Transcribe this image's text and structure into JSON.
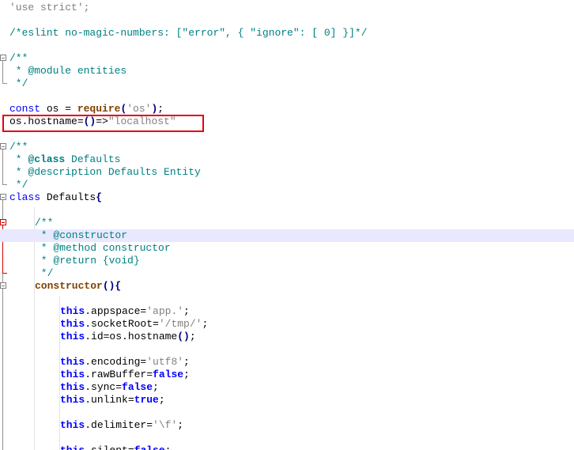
{
  "editor": {
    "highlighted_line": 18,
    "lines": [
      {
        "indent": 0,
        "tokens": [
          {
            "t": "str",
            "v": "'use strict';"
          }
        ]
      },
      {
        "indent": 0,
        "tokens": []
      },
      {
        "indent": 0,
        "tokens": [
          {
            "t": "cm",
            "v": "/*eslint no-magic-numbers: [\"error\", { \"ignore\": [ 0] }]*/"
          }
        ]
      },
      {
        "indent": 0,
        "tokens": []
      },
      {
        "indent": 0,
        "tokens": [
          {
            "t": "cm",
            "v": "/**"
          }
        ]
      },
      {
        "indent": 0,
        "tokens": [
          {
            "t": "cm",
            "v": " * @module entities"
          }
        ]
      },
      {
        "indent": 0,
        "tokens": [
          {
            "t": "cm",
            "v": " */"
          }
        ]
      },
      {
        "indent": 0,
        "tokens": []
      },
      {
        "indent": 0,
        "tokens": [
          {
            "t": "kw2",
            "v": "const"
          },
          {
            "t": "pl",
            "v": " os = "
          },
          {
            "t": "fn",
            "v": "require"
          },
          {
            "t": "op",
            "v": "("
          },
          {
            "t": "str",
            "v": "'os'"
          },
          {
            "t": "op",
            "v": ")"
          },
          {
            "t": "pl",
            "v": ";"
          }
        ]
      },
      {
        "indent": 0,
        "tokens": [
          {
            "t": "pl",
            "v": "os.hostname="
          },
          {
            "t": "op",
            "v": "()"
          },
          {
            "t": "pl",
            "v": "=>"
          },
          {
            "t": "str",
            "v": "\"localhost\""
          }
        ]
      },
      {
        "indent": 0,
        "tokens": []
      },
      {
        "indent": 0,
        "tokens": [
          {
            "t": "cm",
            "v": "/**"
          }
        ]
      },
      {
        "indent": 0,
        "tokens": [
          {
            "t": "cm",
            "v": " * "
          },
          {
            "t": "cm-bold",
            "v": "@class"
          },
          {
            "t": "cm",
            "v": " Defaults"
          }
        ]
      },
      {
        "indent": 0,
        "tokens": [
          {
            "t": "cm",
            "v": " * @description Defaults Entity"
          }
        ]
      },
      {
        "indent": 0,
        "tokens": [
          {
            "t": "cm",
            "v": " */"
          }
        ]
      },
      {
        "indent": 0,
        "tokens": [
          {
            "t": "kw2",
            "v": "class"
          },
          {
            "t": "pl",
            "v": " Defaults"
          },
          {
            "t": "op",
            "v": "{"
          }
        ]
      },
      {
        "indent": 0,
        "tokens": []
      },
      {
        "indent": 4,
        "tokens": [
          {
            "t": "cm",
            "v": "/**"
          }
        ]
      },
      {
        "indent": 4,
        "tokens": [
          {
            "t": "cm",
            "v": " * @constructor"
          }
        ]
      },
      {
        "indent": 4,
        "tokens": [
          {
            "t": "cm",
            "v": " * @method constructor"
          }
        ]
      },
      {
        "indent": 4,
        "tokens": [
          {
            "t": "cm",
            "v": " * @return {void}"
          }
        ]
      },
      {
        "indent": 4,
        "tokens": [
          {
            "t": "cm",
            "v": " */"
          }
        ]
      },
      {
        "indent": 4,
        "tokens": [
          {
            "t": "fn",
            "v": "constructor"
          },
          {
            "t": "op",
            "v": "(){"
          }
        ]
      },
      {
        "indent": 0,
        "tokens": []
      },
      {
        "indent": 8,
        "tokens": [
          {
            "t": "kw",
            "v": "this"
          },
          {
            "t": "pl",
            "v": ".appspace="
          },
          {
            "t": "str",
            "v": "'app.'"
          },
          {
            "t": "pl",
            "v": ";"
          }
        ]
      },
      {
        "indent": 8,
        "tokens": [
          {
            "t": "kw",
            "v": "this"
          },
          {
            "t": "pl",
            "v": ".socketRoot="
          },
          {
            "t": "str",
            "v": "'/tmp/'"
          },
          {
            "t": "pl",
            "v": ";"
          }
        ]
      },
      {
        "indent": 8,
        "tokens": [
          {
            "t": "kw",
            "v": "this"
          },
          {
            "t": "pl",
            "v": ".id=os.hostname"
          },
          {
            "t": "op",
            "v": "()"
          },
          {
            "t": "pl",
            "v": ";"
          }
        ]
      },
      {
        "indent": 0,
        "tokens": []
      },
      {
        "indent": 8,
        "tokens": [
          {
            "t": "kw",
            "v": "this"
          },
          {
            "t": "pl",
            "v": ".encoding="
          },
          {
            "t": "str",
            "v": "'utf8'"
          },
          {
            "t": "pl",
            "v": ";"
          }
        ]
      },
      {
        "indent": 8,
        "tokens": [
          {
            "t": "kw",
            "v": "this"
          },
          {
            "t": "pl",
            "v": ".rawBuffer="
          },
          {
            "t": "kw",
            "v": "false"
          },
          {
            "t": "pl",
            "v": ";"
          }
        ]
      },
      {
        "indent": 8,
        "tokens": [
          {
            "t": "kw",
            "v": "this"
          },
          {
            "t": "pl",
            "v": ".sync="
          },
          {
            "t": "kw",
            "v": "false"
          },
          {
            "t": "pl",
            "v": ";"
          }
        ]
      },
      {
        "indent": 8,
        "tokens": [
          {
            "t": "kw",
            "v": "this"
          },
          {
            "t": "pl",
            "v": ".unlink="
          },
          {
            "t": "kw",
            "v": "true"
          },
          {
            "t": "pl",
            "v": ";"
          }
        ]
      },
      {
        "indent": 0,
        "tokens": []
      },
      {
        "indent": 8,
        "tokens": [
          {
            "t": "kw",
            "v": "this"
          },
          {
            "t": "pl",
            "v": ".delimiter="
          },
          {
            "t": "str",
            "v": "'\\f'"
          },
          {
            "t": "pl",
            "v": ";"
          }
        ]
      },
      {
        "indent": 0,
        "tokens": []
      },
      {
        "indent": 8,
        "tokens": [
          {
            "t": "kw",
            "v": "this"
          },
          {
            "t": "pl",
            "v": ".silent="
          },
          {
            "t": "kw",
            "v": "false"
          },
          {
            "t": "pl",
            "v": ";"
          }
        ]
      }
    ]
  },
  "annotation": {
    "label": "highlighted-line-marker",
    "color": "#e8000f"
  },
  "colors": {
    "keyword": "#0000ff",
    "comment": "#008080",
    "string": "#808080",
    "function": "#804000",
    "current_line": "#e8e8ff"
  }
}
